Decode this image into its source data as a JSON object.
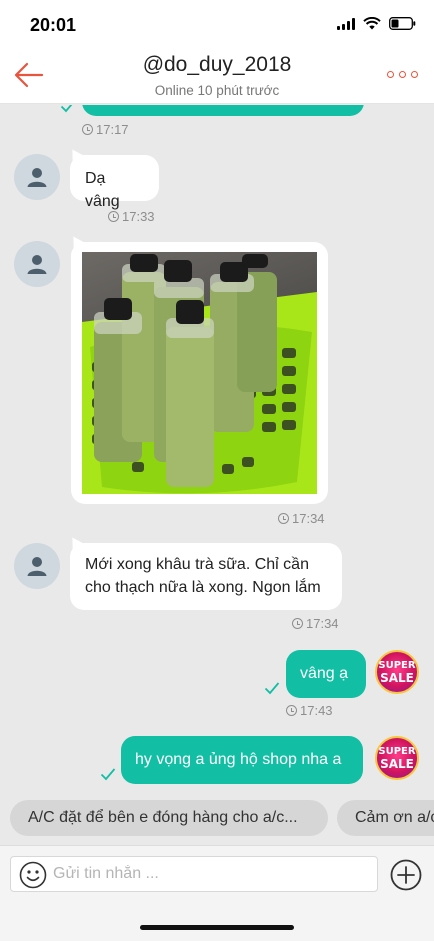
{
  "status_bar": {
    "time": "20:01"
  },
  "header": {
    "title": "@do_duy_2018",
    "subtitle": "Online 10 phút trước",
    "back_icon": "arrow-left-icon",
    "more_icon": "more-dots-icon"
  },
  "colors": {
    "accent": "#e8543c",
    "outgoing_bubble": "#13bfa4",
    "background": "#e9e9e9"
  },
  "messages": [
    {
      "direction": "out",
      "text": "",
      "time": "17:17",
      "read": true
    },
    {
      "direction": "in",
      "text": "Dạ vâng",
      "time": "17:33"
    },
    {
      "direction": "in",
      "type": "image",
      "image": "milk-tea-bottles-photo",
      "time": "17:34"
    },
    {
      "direction": "in",
      "text": "Mới xong khâu trà sữa. Chỉ cần cho thạch nữa là xong. Ngon lắm",
      "time": "17:34"
    },
    {
      "direction": "out",
      "text": "vâng ạ",
      "time": "17:43",
      "read": true,
      "badge": [
        "SUPER",
        "SALE"
      ]
    },
    {
      "direction": "out",
      "text": "hy vọng a ủng hộ shop nha a",
      "read": true,
      "badge": [
        "SUPER",
        "SALE"
      ]
    }
  ],
  "quick_replies": [
    "A/C đặt để bên e đóng hàng cho a/c...",
    "Cảm ơn a/c"
  ],
  "composer": {
    "placeholder": "Gửi tin nhắn ...",
    "emoji_icon": "emoji-smile-icon",
    "add_icon": "plus-circle-icon"
  }
}
